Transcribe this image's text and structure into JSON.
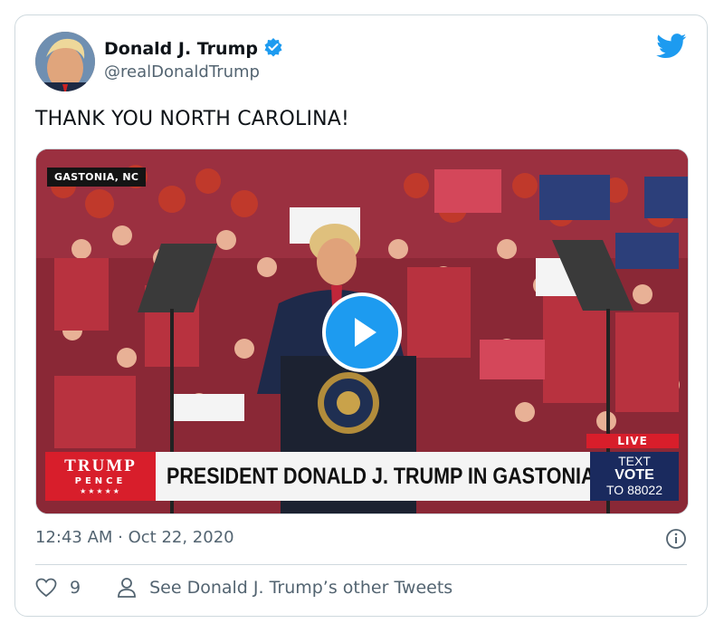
{
  "tweet": {
    "author_name": "Donald J. Trump",
    "handle": "@realDonaldTrump",
    "verified": true,
    "text": "THANK YOU NORTH CAROLINA!",
    "timestamp": "12:43 AM · Oct 22, 2020",
    "likes": "9",
    "other_tweets_label": "See Donald J. Trump’s other Tweets"
  },
  "video": {
    "location_tag": "GASTONIA, NC",
    "live_badge": "LIVE",
    "logo_line1": "TRUMP",
    "logo_line2": "PENCE",
    "logo_stars": "★★★★★",
    "headline": "PRESIDENT DONALD J. TRUMP IN GASTONIA, NC",
    "text_line1": "TEXT",
    "text_line2": "VOTE",
    "text_line3": "TO 88022"
  },
  "icons": {
    "brand": "twitter-bird-icon",
    "verified": "verified-badge-icon",
    "play": "play-icon",
    "info": "info-icon",
    "like": "heart-icon",
    "profile": "person-icon"
  },
  "colors": {
    "brand_blue": "#1d9bf0",
    "secondary_text": "#536471",
    "border": "#cfd9de",
    "live_red": "#d81e2b",
    "vote_navy": "#1a2a5e"
  }
}
